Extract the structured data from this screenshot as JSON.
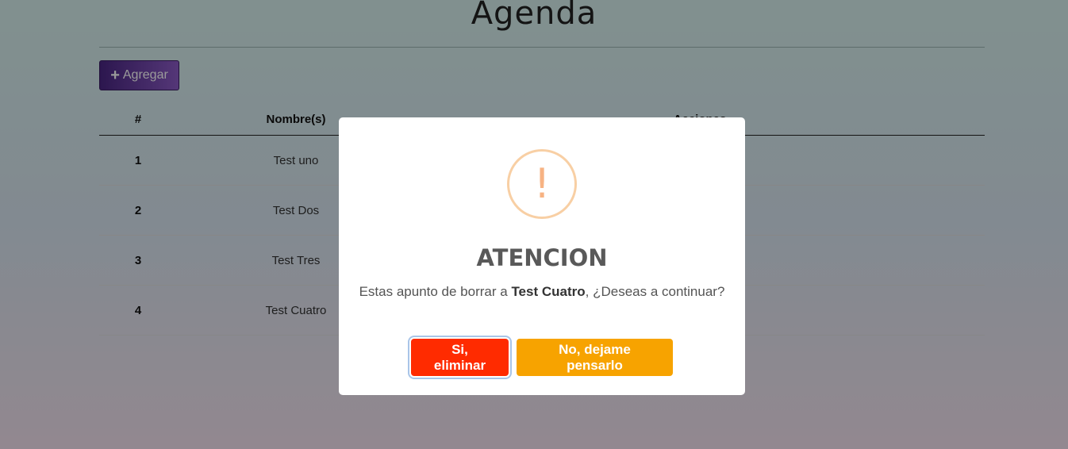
{
  "page": {
    "title": "Agenda",
    "add_label": "Agregar"
  },
  "table": {
    "headers": {
      "num": "#",
      "name": "Nombre(s)",
      "actions": "Acciones"
    },
    "rows": [
      {
        "num": "1",
        "name": "Test uno"
      },
      {
        "num": "2",
        "name": "Test Dos"
      },
      {
        "num": "3",
        "name": "Test Tres"
      },
      {
        "num": "4",
        "name": "Test Cuatro"
      }
    ]
  },
  "modal": {
    "icon": "exclamation-icon",
    "icon_glyph": "!",
    "title": "ATENCION",
    "text_before": "Estas apunto de borrar a ",
    "target_name": "Test Cuatro",
    "text_after": ", ¿Deseas a continuar?",
    "confirm_label": "Si, eliminar",
    "cancel_label": "No, dejame pensarlo"
  },
  "colors": {
    "confirm": "#ff2b00",
    "cancel": "#f7a300",
    "edit": "#1f63d8",
    "delete": "#d8333f",
    "add": "#5b3596"
  }
}
